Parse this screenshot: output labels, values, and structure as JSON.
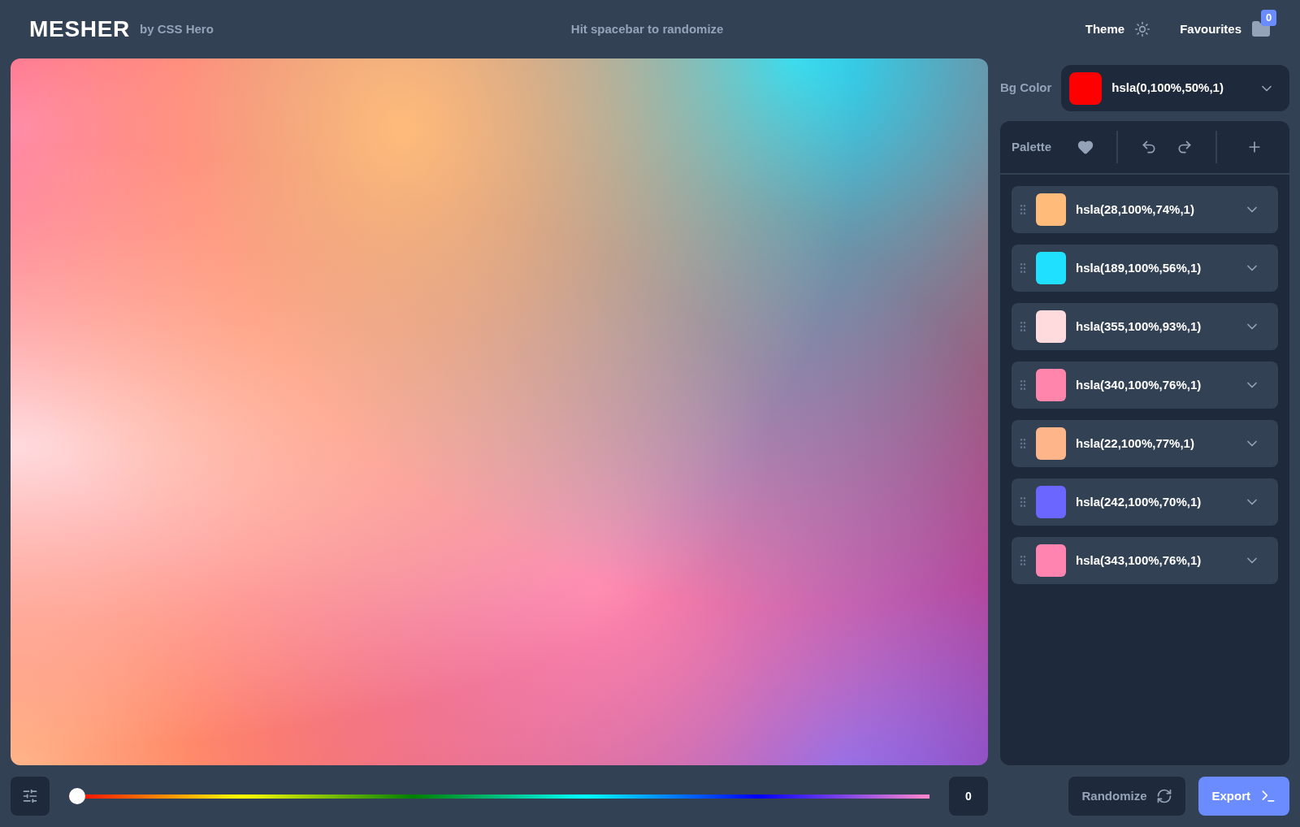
{
  "header": {
    "logo": "MESHER",
    "byline": "by CSS Hero",
    "hint": "Hit spacebar to randomize",
    "theme_label": "Theme",
    "favourites_label": "Favourites",
    "favourites_count": "0"
  },
  "bg_color": {
    "label": "Bg Color",
    "value": "hsla(0,100%,50%,1)",
    "color": "#ff0000"
  },
  "palette": {
    "label": "Palette",
    "colors": [
      {
        "value": "hsla(28,100%,74%,1)",
        "color": "#ffbb7a"
      },
      {
        "value": "hsla(189,100%,56%,1)",
        "color": "#1fe1ff"
      },
      {
        "value": "hsla(355,100%,93%,1)",
        "color": "#ffdbde"
      },
      {
        "value": "hsla(340,100%,76%,1)",
        "color": "#ff85ad"
      },
      {
        "value": "hsla(22,100%,77%,1)",
        "color": "#ffb58a"
      },
      {
        "value": "hsla(242,100%,70%,1)",
        "color": "#6b66ff"
      },
      {
        "value": "hsla(343,100%,76%,1)",
        "color": "#ff85b0"
      }
    ]
  },
  "hue_slider": {
    "level": 0,
    "reading": "0"
  },
  "buttons": {
    "randomize": "Randomize",
    "export": "Export"
  }
}
